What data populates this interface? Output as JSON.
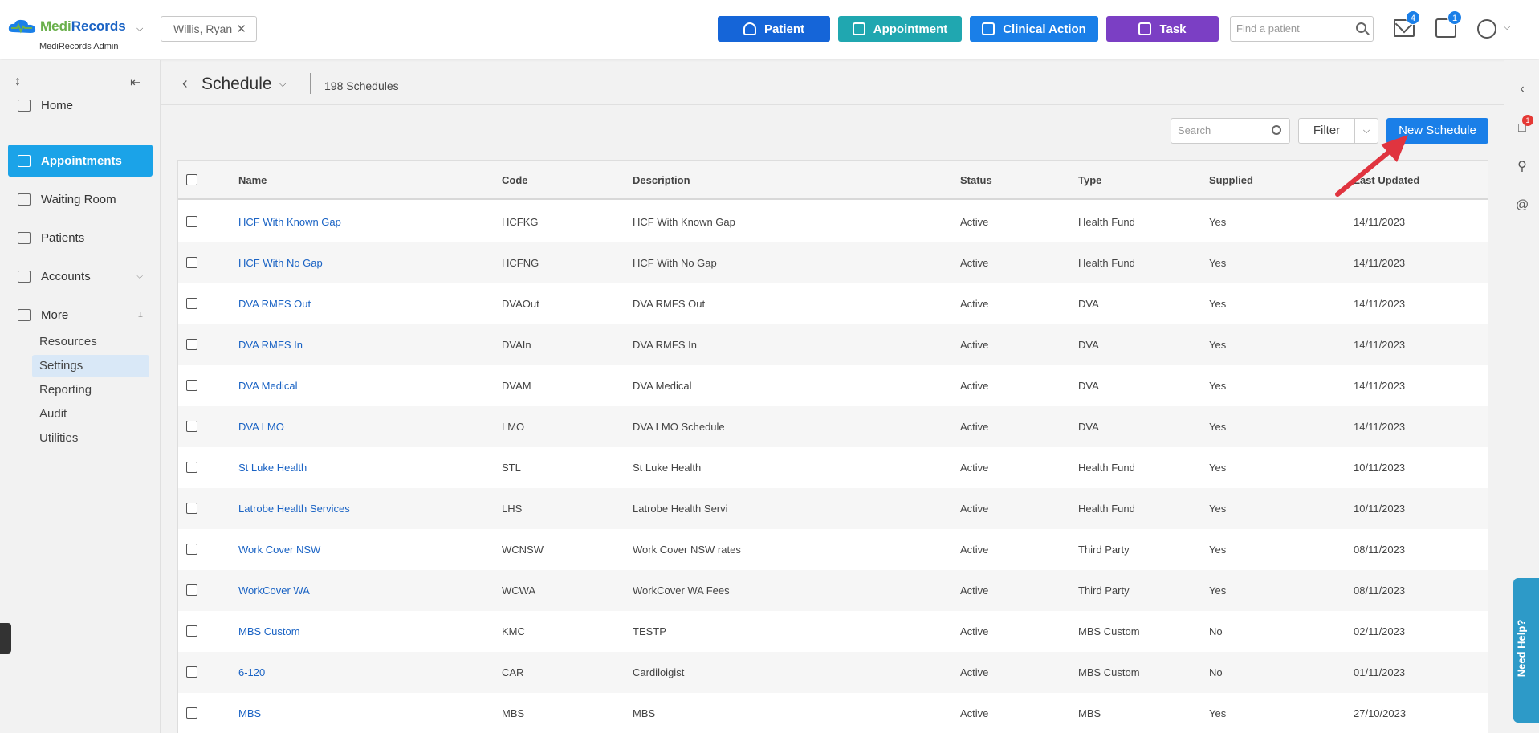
{
  "header": {
    "logo_medi": "Medi",
    "logo_records": "Records",
    "logo_sub": "MediRecords Admin",
    "patient_chip": "Willis, Ryan",
    "buttons": {
      "patient": "Patient",
      "appointment": "Appointment",
      "clinical": "Clinical Action",
      "task": "Task"
    },
    "find_placeholder": "Find a patient",
    "mail_count": "4",
    "task_count": "1"
  },
  "sidebar": {
    "items": [
      {
        "label": "Home"
      },
      {
        "label": "Appointments"
      },
      {
        "label": "Waiting Room"
      },
      {
        "label": "Patients"
      },
      {
        "label": "Accounts"
      },
      {
        "label": "More"
      }
    ],
    "more_items": [
      "Resources",
      "Settings",
      "Reporting",
      "Audit",
      "Utilities"
    ]
  },
  "rail": {
    "notification_count": "1",
    "help_label": "Need Help?"
  },
  "main": {
    "title": "Schedule",
    "count": "198 Schedules",
    "search_placeholder": "Search",
    "filter_label": "Filter",
    "new_button": "New Schedule",
    "columns": [
      "Name",
      "Code",
      "Description",
      "Status",
      "Type",
      "Supplied",
      "Last Updated"
    ],
    "rows": [
      [
        "HCF With Known Gap",
        "HCFKG",
        "HCF With Known Gap",
        "Active",
        "Health Fund",
        "Yes",
        "14/11/2023"
      ],
      [
        "HCF With No Gap",
        "HCFNG",
        "HCF With No Gap",
        "Active",
        "Health Fund",
        "Yes",
        "14/11/2023"
      ],
      [
        "DVA RMFS Out",
        "DVAOut",
        "DVA RMFS Out",
        "Active",
        "DVA",
        "Yes",
        "14/11/2023"
      ],
      [
        "DVA RMFS In",
        "DVAIn",
        "DVA RMFS In",
        "Active",
        "DVA",
        "Yes",
        "14/11/2023"
      ],
      [
        "DVA Medical",
        "DVAM",
        "DVA Medical",
        "Active",
        "DVA",
        "Yes",
        "14/11/2023"
      ],
      [
        "DVA LMO",
        "LMO",
        "DVA LMO Schedule",
        "Active",
        "DVA",
        "Yes",
        "14/11/2023"
      ],
      [
        "St Luke Health",
        "STL",
        "St Luke Health",
        "Active",
        "Health Fund",
        "Yes",
        "10/11/2023"
      ],
      [
        "Latrobe Health Services",
        "LHS",
        "Latrobe Health Servi",
        "Active",
        "Health Fund",
        "Yes",
        "10/11/2023"
      ],
      [
        "Work Cover NSW",
        "WCNSW",
        "Work Cover NSW rates",
        "Active",
        "Third Party",
        "Yes",
        "08/11/2023"
      ],
      [
        "WorkCover WA",
        "WCWA",
        "WorkCover WA Fees",
        "Active",
        "Third Party",
        "Yes",
        "08/11/2023"
      ],
      [
        "MBS Custom",
        "KMC",
        "TESTP",
        "Active",
        "MBS Custom",
        "No",
        "02/11/2023"
      ],
      [
        "6-120",
        "CAR",
        "Cardiloigist",
        "Active",
        "MBS Custom",
        "No",
        "01/11/2023"
      ],
      [
        "MBS",
        "MBS",
        "MBS",
        "Active",
        "MBS",
        "Yes",
        "27/10/2023"
      ]
    ]
  },
  "colors": {
    "primary": "#1a7fe8",
    "nav_active": "#1ba3e8",
    "arrow": "#e0343f"
  }
}
